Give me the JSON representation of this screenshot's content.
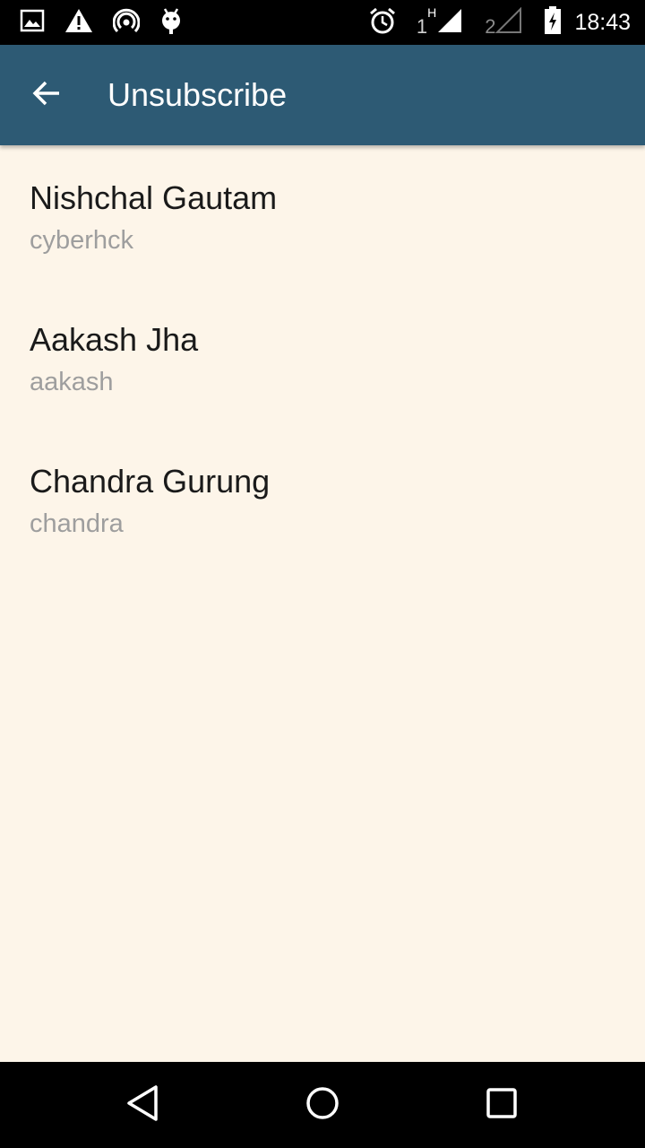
{
  "status_bar": {
    "time": "18:43",
    "sim1_label": "1",
    "sim1_network": "H",
    "sim2_label": "2",
    "icons": [
      "image-icon",
      "warning-icon",
      "hotspot-icon",
      "android-debug-icon",
      "alarm-icon",
      "signal-icon",
      "signal-empty-icon",
      "battery-charging-icon"
    ]
  },
  "app_bar": {
    "title": "Unsubscribe",
    "back_icon": "arrow-back-icon",
    "background_color": "#2d5a74"
  },
  "list": {
    "items": [
      {
        "name": "Nishchal Gautam",
        "username": "cyberhck"
      },
      {
        "name": "Aakash Jha",
        "username": "aakash"
      },
      {
        "name": "Chandra Gurung",
        "username": "chandra"
      }
    ]
  },
  "nav_bar": {
    "icons": [
      "nav-back-icon",
      "nav-home-icon",
      "nav-recents-icon"
    ]
  },
  "colors": {
    "page_background": "#fdf5e9",
    "primary_text": "#1a1a1a",
    "secondary_text": "#9e9e9e"
  }
}
